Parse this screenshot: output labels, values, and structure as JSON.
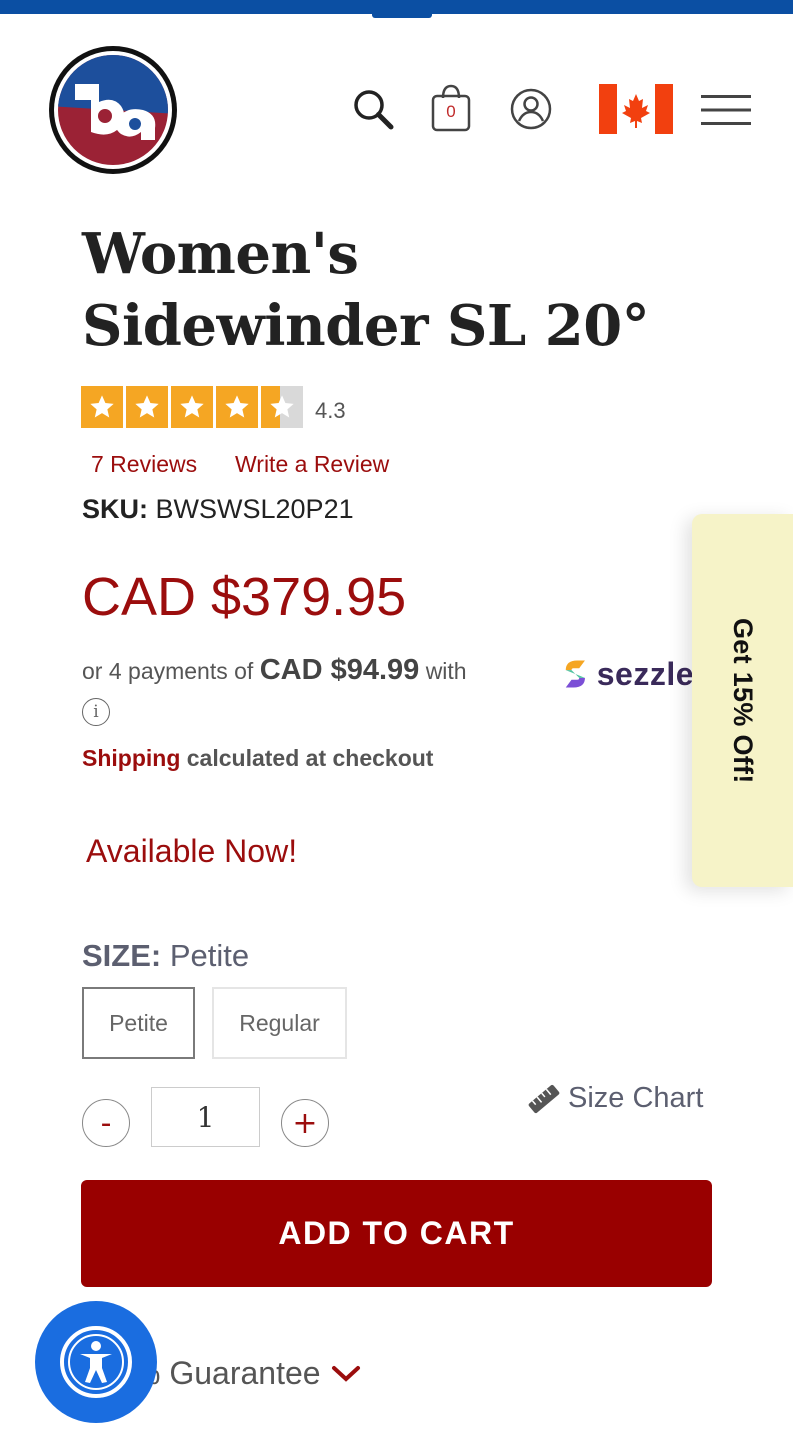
{
  "header": {
    "bag_count": "0",
    "icons": [
      "search-icon",
      "shopping-bag-icon",
      "account-icon",
      "canada-flag-icon",
      "hamburger-menu-icon"
    ]
  },
  "product": {
    "title_line1": "Women's",
    "title_line2": "Sidewinder SL 20°",
    "rating_value": "4.3",
    "rating_stars": 4.3,
    "reviews_link": "7 Reviews",
    "write_review_link": "Write a Review",
    "sku_label": "SKU:",
    "sku_value": "BWSWSL20P21",
    "price": "CAD $379.95",
    "payments_prefix": "or 4 payments of",
    "payments_amount": "CAD $94.99",
    "payments_suffix": "with",
    "payments_provider": "sezzle",
    "shipping_link": "Shipping",
    "shipping_text": "calculated at checkout",
    "availability": "Available Now!"
  },
  "promo": {
    "label": "Get 15% Off!"
  },
  "size": {
    "label": "SIZE:",
    "selected": "Petite",
    "options": [
      "Petite",
      "Regular"
    ]
  },
  "quantity": {
    "minus": "-",
    "value": "1",
    "plus": "+"
  },
  "size_chart": {
    "label": "Size Chart"
  },
  "add_to_cart": {
    "label": "ADD TO CART"
  },
  "guarantee": {
    "label": "% Guarantee"
  },
  "colors": {
    "brand_blue": "#0b4fa3",
    "brand_red": "#9b0d0d",
    "cart_button": "#990000",
    "star_orange": "#f5a623",
    "promo_bg": "#f6f3c8",
    "a11y_blue": "#1a6de0"
  }
}
